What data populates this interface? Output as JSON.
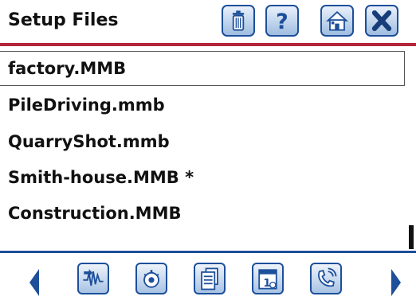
{
  "header": {
    "title": "Setup Files",
    "buttons": [
      {
        "icon": "trash-icon"
      },
      {
        "icon": "help-icon"
      },
      {
        "icon": "home-icon"
      },
      {
        "icon": "close-icon"
      }
    ]
  },
  "files": [
    {
      "name": "factory.MMB",
      "selected": true
    },
    {
      "name": "PileDriving.mmb",
      "selected": false
    },
    {
      "name": "QuarryShot.mmb",
      "selected": false
    },
    {
      "name": "Smith-house.MMB *",
      "selected": false
    },
    {
      "name": "Construction.MMB",
      "selected": false
    }
  ],
  "toolbar": {
    "icons": [
      "waveform-icon",
      "settings-dial-icon",
      "documents-icon",
      "calendar-icon",
      "phone-icon"
    ]
  },
  "colors": {
    "accent_blue": "#1d4f9a",
    "header_rule_red": "#b3263a"
  }
}
